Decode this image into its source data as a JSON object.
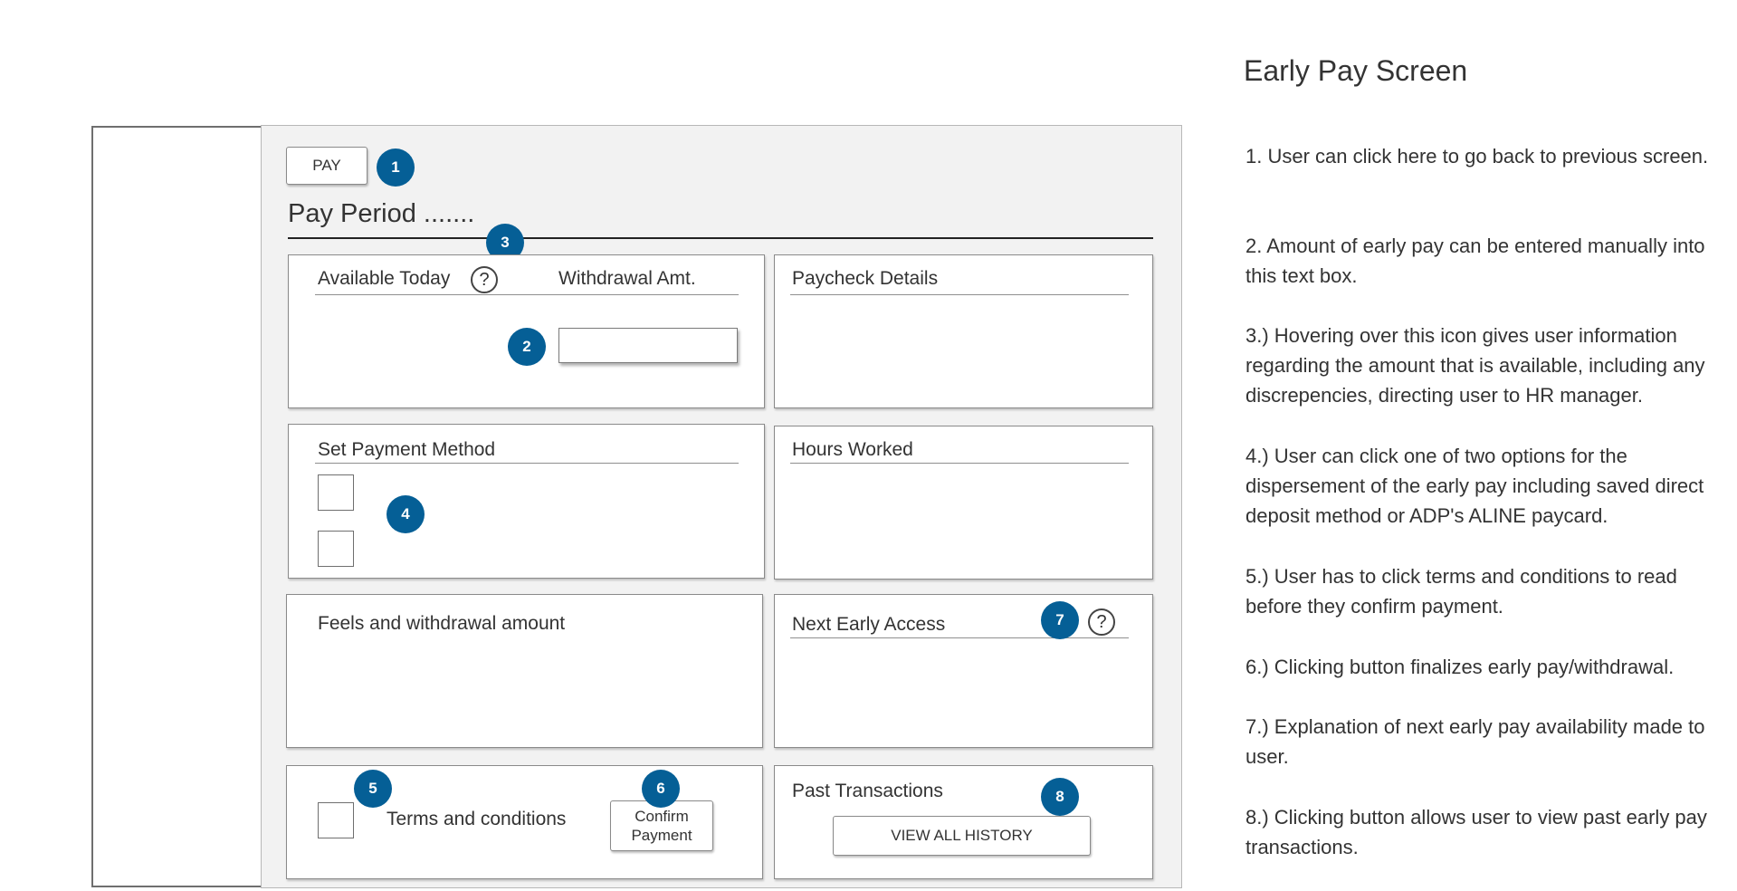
{
  "header": {
    "pay_button_label": "PAY",
    "pay_period_title": "Pay Period ......."
  },
  "badges": [
    "1",
    "2",
    "3",
    "4",
    "5",
    "6",
    "7",
    "8"
  ],
  "cards": {
    "available_today": "Available Today",
    "withdrawal_amt": "Withdrawal Amt.",
    "paycheck_details": "Paycheck Details",
    "set_payment_method": "Set Payment Method",
    "hours_worked": "Hours Worked",
    "fees_withdrawal": "Feels and withdrawal amount",
    "next_early_access": "Next Early Access",
    "terms_conditions": "Terms and conditions",
    "confirm_payment_line1": "Confirm",
    "confirm_payment_line2": "Payment",
    "past_transactions": "Past Transactions",
    "view_all_history": "VIEW ALL HISTORY"
  },
  "help_icon_glyph": "?",
  "icons": [
    "help-icon"
  ],
  "colors": {
    "badge": "#055f96",
    "panel_bg": "#f2f2f2"
  },
  "notes": {
    "title": "Early Pay Screen",
    "items": [
      "1. User can click here to go back to previous screen.",
      "2. Amount of early pay can be entered manually into this text box.",
      "3.) Hovering over this icon gives user information regarding the amount that is available, including any discrepencies, directing user to HR manager.",
      "4.) User can click one of two options for the dispersement of the early pay including saved direct deposit method or ADP's ALINE paycard.",
      "5.) User has to click terms and conditions to read before they confirm payment.",
      "6.) Clicking button finalizes early pay/withdrawal.",
      "7.) Explanation of next early pay availability made to user.",
      "8.) Clicking button allows user to view past early pay transactions."
    ]
  }
}
